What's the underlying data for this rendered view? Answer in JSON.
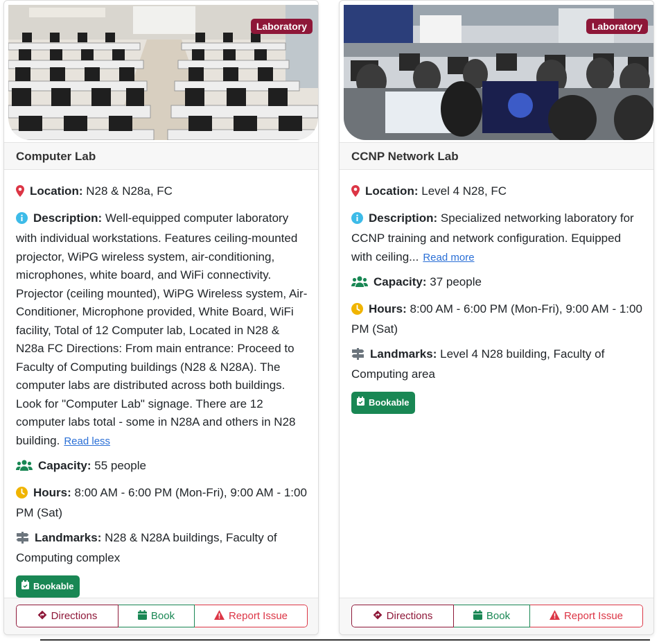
{
  "cards": [
    {
      "category": "Laboratory",
      "title": "Computer Lab",
      "location_label": "Location:",
      "location": "N28 & N28a, FC",
      "description_label": "Description:",
      "description": "Well-equipped computer laboratory with individual workstations. Features ceiling-mounted projector, WiPG wireless system, air-conditioning, microphones, white board, and WiFi connectivity. Projector (ceiling mounted), WiPG Wireless system, Air-Conditioner, Microphone provided, White Board, WiFi facility, Total of 12 Computer lab, Located in N28 & N28a FC Directions: From main entrance: Proceed to Faculty of Computing buildings (N28 & N28A). The computer labs are distributed across both buildings. Look for \"Computer Lab\" signage. There are 12 computer labs total - some in N28A and others in N28 building.",
      "read_toggle": "Read less",
      "capacity_label": "Capacity:",
      "capacity": "55 people",
      "hours_label": "Hours:",
      "hours": "8:00 AM - 6:00 PM (Mon-Fri), 9:00 AM - 1:00 PM (Sat)",
      "landmarks_label": "Landmarks:",
      "landmarks": "N28 & N28A buildings, Faculty of Computing complex",
      "status": "Bookable",
      "buttons": {
        "directions": "Directions",
        "book": "Book",
        "report": "Report Issue"
      }
    },
    {
      "category": "Laboratory",
      "title": "CCNP Network Lab",
      "location_label": "Location:",
      "location": "Level 4 N28, FC",
      "description_label": "Description:",
      "description": "Specialized networking laboratory for CCNP training and network configuration. Equipped with ceiling...",
      "read_toggle": "Read more",
      "capacity_label": "Capacity:",
      "capacity": "37 people",
      "hours_label": "Hours:",
      "hours": "8:00 AM - 6:00 PM (Mon-Fri), 9:00 AM - 1:00 PM (Sat)",
      "landmarks_label": "Landmarks:",
      "landmarks": "Level 4 N28 building, Faculty of Computing area",
      "status": "Bookable",
      "buttons": {
        "directions": "Directions",
        "book": "Book",
        "report": "Report Issue"
      }
    }
  ],
  "colors": {
    "brand": "#8e1738",
    "success": "#198754",
    "danger": "#dc3545",
    "location_icon": "#dc3545",
    "info_icon": "#3dbbe8",
    "capacity_icon": "#198754",
    "hours_icon": "#f0b400",
    "landmarks_icon": "#6c757d"
  },
  "icons": {
    "location": "map-marker-icon",
    "description": "info-circle-icon",
    "capacity": "users-icon",
    "hours": "clock-icon",
    "landmarks": "signpost-icon",
    "bookable": "calendar-check-icon",
    "directions": "diamond-turn-icon",
    "book": "calendar-icon",
    "report": "warning-triangle-icon"
  }
}
